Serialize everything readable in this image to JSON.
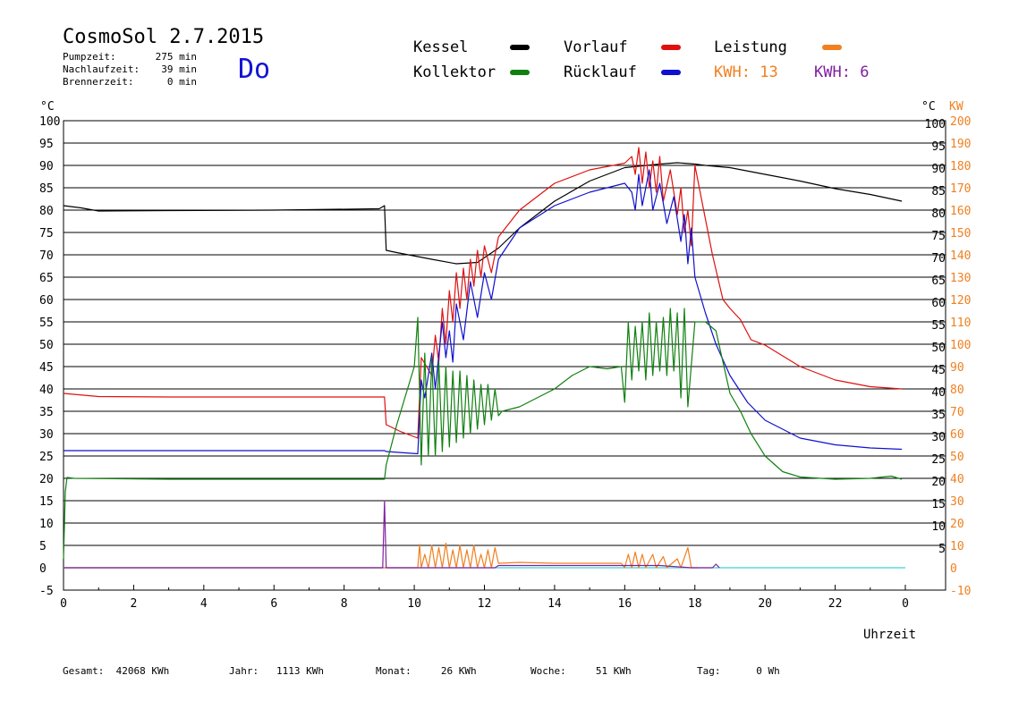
{
  "header": {
    "title": "CosmoSol 2.7.2015",
    "day": "Do",
    "stats": [
      {
        "label": "Pumpzeit:",
        "value": "275 min"
      },
      {
        "label": "Nachlaufzeit:",
        "value": "39 min"
      },
      {
        "label": "Brennerzeit:",
        "value": "0 min"
      }
    ]
  },
  "legend": {
    "kessel": {
      "label": "Kessel",
      "color": "#000000"
    },
    "vorlauf": {
      "label": "Vorlauf",
      "color": "#e01010"
    },
    "leistung": {
      "label": "Leistung",
      "color": "#f08020"
    },
    "kollektor": {
      "label": "Kollektor",
      "color": "#108010"
    },
    "ruecklauf": {
      "label": "Rücklauf",
      "color": "#1010d0"
    },
    "kwh1": {
      "label": "KWH:",
      "value": "13",
      "color": "#f08020"
    },
    "kwh2": {
      "label": "KWH:",
      "value": "6",
      "color": "#8020a0"
    }
  },
  "axis_units": {
    "left": "°C",
    "right_temp": "°C",
    "right_power": "KW",
    "x": "Uhrzeit"
  },
  "footer": [
    {
      "label": "Gesamt:",
      "value": "42068 KWh"
    },
    {
      "label": "Jahr:",
      "value": "1113 KWh"
    },
    {
      "label": "Monat:",
      "value": "26 KWh"
    },
    {
      "label": "Woche:",
      "value": "51 KWh"
    },
    {
      "label": "Tag:",
      "value": "0 Wh"
    }
  ],
  "chart_data": {
    "type": "line",
    "xlabel": "Uhrzeit",
    "ylabel": "°C",
    "y2label": "KW",
    "xlim": [
      0,
      24.5
    ],
    "ylim": [
      -5,
      100
    ],
    "y2lim": [
      -10,
      200
    ],
    "x_ticks": [
      "0",
      "2",
      "4",
      "6",
      "8",
      "10",
      "12",
      "14",
      "16",
      "18",
      "20",
      "22",
      "0"
    ],
    "y_ticks_left": [
      "100",
      "95",
      "90",
      "85",
      "80",
      "75",
      "70",
      "65",
      "60",
      "55",
      "50",
      "45",
      "40",
      "35",
      "30",
      "25",
      "20",
      "15",
      "10",
      "5",
      "0",
      "-5"
    ],
    "y_ticks_right_temp": [
      "100",
      "95",
      "90",
      "85",
      "80",
      "75",
      "70",
      "65",
      "60",
      "55",
      "50",
      "45",
      "40",
      "35",
      "30",
      "25",
      "20",
      "15",
      "10",
      "5"
    ],
    "y_ticks_right_power": [
      "200",
      "190",
      "180",
      "170",
      "160",
      "150",
      "140",
      "130",
      "120",
      "110",
      "100",
      "90",
      "80",
      "70",
      "60",
      "50",
      "40",
      "30",
      "20",
      "10",
      "0",
      "-10"
    ],
    "grid": true,
    "colors": {
      "kessel": "#000000",
      "vorlauf": "#e01010",
      "ruecklauf": "#1010d0",
      "kollektor": "#108010",
      "leistung": "#f08020",
      "kwh2": "#8020a0",
      "baseline": "#40d0d0"
    },
    "series": [
      {
        "name": "Kessel",
        "key": "kessel",
        "points": [
          [
            0,
            81
          ],
          [
            0.5,
            80.5
          ],
          [
            1,
            79.8
          ],
          [
            3,
            79.9
          ],
          [
            6,
            80
          ],
          [
            9.0,
            80.3
          ],
          [
            9.15,
            81
          ],
          [
            9.2,
            71
          ],
          [
            9.5,
            70.5
          ],
          [
            10.5,
            69
          ],
          [
            11.2,
            68
          ],
          [
            11.8,
            68.3
          ],
          [
            12.4,
            71.5
          ],
          [
            13,
            76
          ],
          [
            14,
            82
          ],
          [
            15,
            86.5
          ],
          [
            16,
            89.5
          ],
          [
            17,
            90.3
          ],
          [
            17.5,
            90.6
          ],
          [
            18,
            90.3
          ],
          [
            18.3,
            90
          ],
          [
            19,
            89.5
          ],
          [
            20,
            88
          ],
          [
            21,
            86.5
          ],
          [
            22,
            84.8
          ],
          [
            23,
            83.5
          ],
          [
            23.9,
            82
          ]
        ]
      },
      {
        "name": "Vorlauf",
        "key": "vorlauf",
        "points": [
          [
            0,
            39
          ],
          [
            1,
            38.3
          ],
          [
            3,
            38.2
          ],
          [
            6,
            38.2
          ],
          [
            9.15,
            38.2
          ],
          [
            9.2,
            32
          ],
          [
            9.6,
            30.5
          ],
          [
            10.1,
            29
          ],
          [
            10.2,
            47
          ],
          [
            10.5,
            43
          ],
          [
            10.6,
            52
          ],
          [
            10.7,
            46
          ],
          [
            10.8,
            58
          ],
          [
            10.9,
            50
          ],
          [
            11,
            62
          ],
          [
            11.1,
            55
          ],
          [
            11.2,
            66
          ],
          [
            11.3,
            58
          ],
          [
            11.4,
            67
          ],
          [
            11.5,
            60
          ],
          [
            11.6,
            69
          ],
          [
            11.7,
            63
          ],
          [
            11.8,
            71
          ],
          [
            11.9,
            65
          ],
          [
            12,
            72
          ],
          [
            12.2,
            66
          ],
          [
            12.4,
            74
          ],
          [
            13,
            80
          ],
          [
            14,
            86
          ],
          [
            15,
            89
          ],
          [
            16,
            90.5
          ],
          [
            16.2,
            92
          ],
          [
            16.3,
            88
          ],
          [
            16.4,
            94
          ],
          [
            16.5,
            86
          ],
          [
            16.6,
            93
          ],
          [
            16.7,
            85
          ],
          [
            16.8,
            91
          ],
          [
            16.9,
            84
          ],
          [
            17,
            92
          ],
          [
            17.1,
            82
          ],
          [
            17.3,
            89
          ],
          [
            17.5,
            79
          ],
          [
            17.6,
            85
          ],
          [
            17.7,
            75
          ],
          [
            17.8,
            80
          ],
          [
            17.9,
            72
          ],
          [
            18,
            90
          ],
          [
            18.2,
            82
          ],
          [
            18.5,
            70
          ],
          [
            18.8,
            60
          ],
          [
            19,
            58
          ],
          [
            19.3,
            55.5
          ],
          [
            19.6,
            51
          ],
          [
            20,
            49.8
          ],
          [
            21,
            45
          ],
          [
            22,
            42
          ],
          [
            23,
            40.5
          ],
          [
            23.9,
            40
          ]
        ]
      },
      {
        "name": "Rücklauf",
        "key": "ruecklauf",
        "points": [
          [
            0,
            26.2
          ],
          [
            3,
            26.2
          ],
          [
            6,
            26.2
          ],
          [
            9.15,
            26.2
          ],
          [
            9.2,
            26
          ],
          [
            10.1,
            25.5
          ],
          [
            10.2,
            42
          ],
          [
            10.3,
            38
          ],
          [
            10.5,
            48
          ],
          [
            10.6,
            40
          ],
          [
            10.8,
            55
          ],
          [
            10.9,
            47
          ],
          [
            11,
            53
          ],
          [
            11.1,
            46
          ],
          [
            11.2,
            59
          ],
          [
            11.4,
            51
          ],
          [
            11.6,
            64
          ],
          [
            11.8,
            56
          ],
          [
            12,
            66
          ],
          [
            12.2,
            60
          ],
          [
            12.4,
            69
          ],
          [
            13,
            76
          ],
          [
            14,
            81
          ],
          [
            14.5,
            82.5
          ],
          [
            15,
            84
          ],
          [
            16,
            86
          ],
          [
            16.2,
            84
          ],
          [
            16.3,
            80
          ],
          [
            16.4,
            88
          ],
          [
            16.5,
            81
          ],
          [
            16.7,
            89
          ],
          [
            16.8,
            80
          ],
          [
            17,
            86
          ],
          [
            17.2,
            77
          ],
          [
            17.4,
            83
          ],
          [
            17.6,
            73
          ],
          [
            17.7,
            79
          ],
          [
            17.8,
            68
          ],
          [
            17.9,
            76
          ],
          [
            18,
            65
          ],
          [
            18.3,
            57
          ],
          [
            18.6,
            50
          ],
          [
            19,
            43
          ],
          [
            19.5,
            37
          ],
          [
            20,
            33
          ],
          [
            21,
            29
          ],
          [
            22,
            27.5
          ],
          [
            23,
            26.8
          ],
          [
            23.9,
            26.5
          ]
        ]
      },
      {
        "name": "Kollektor",
        "key": "kollektor",
        "points": [
          [
            0,
            2
          ],
          [
            0.05,
            17
          ],
          [
            0.1,
            20.2
          ],
          [
            0.3,
            20
          ],
          [
            3,
            19.8
          ],
          [
            6,
            19.8
          ],
          [
            9.15,
            19.8
          ],
          [
            9.2,
            23
          ],
          [
            9.5,
            32
          ],
          [
            10,
            45
          ],
          [
            10.1,
            56
          ],
          [
            10.2,
            23
          ],
          [
            10.3,
            48
          ],
          [
            10.4,
            25
          ],
          [
            10.5,
            47
          ],
          [
            10.6,
            25
          ],
          [
            10.7,
            46
          ],
          [
            10.8,
            26
          ],
          [
            10.9,
            45
          ],
          [
            11,
            27
          ],
          [
            11.1,
            44
          ],
          [
            11.2,
            28
          ],
          [
            11.3,
            44
          ],
          [
            11.4,
            29
          ],
          [
            11.5,
            43
          ],
          [
            11.6,
            30
          ],
          [
            11.7,
            42
          ],
          [
            11.8,
            31
          ],
          [
            11.9,
            41
          ],
          [
            12,
            32
          ],
          [
            12.1,
            41
          ],
          [
            12.2,
            33
          ],
          [
            12.3,
            40
          ],
          [
            12.4,
            34
          ],
          [
            12.5,
            35
          ],
          [
            13,
            36
          ],
          [
            13.5,
            38
          ],
          [
            14,
            40
          ],
          [
            14.5,
            43
          ],
          [
            15,
            45
          ],
          [
            15.5,
            44.5
          ],
          [
            15.9,
            45
          ],
          [
            16,
            37
          ],
          [
            16.1,
            55
          ],
          [
            16.2,
            42
          ],
          [
            16.3,
            54
          ],
          [
            16.4,
            44
          ],
          [
            16.5,
            55
          ],
          [
            16.6,
            42
          ],
          [
            16.7,
            57
          ],
          [
            16.8,
            43
          ],
          [
            16.9,
            55
          ],
          [
            17,
            44
          ],
          [
            17.1,
            56
          ],
          [
            17.2,
            43
          ],
          [
            17.3,
            58
          ],
          [
            17.4,
            44
          ],
          [
            17.5,
            57
          ],
          [
            17.6,
            38
          ],
          [
            17.7,
            58
          ],
          [
            17.8,
            36
          ],
          [
            18,
            55
          ],
          [
            18.3,
            55
          ],
          [
            18.6,
            53
          ],
          [
            19,
            39
          ],
          [
            19.3,
            35
          ],
          [
            19.6,
            30
          ],
          [
            20,
            25
          ],
          [
            20.5,
            21.5
          ],
          [
            21,
            20.3
          ],
          [
            22,
            19.8
          ],
          [
            23,
            20
          ],
          [
            23.6,
            20.5
          ],
          [
            23.9,
            19.8
          ]
        ]
      },
      {
        "name": "Leistung",
        "key": "leistung",
        "points": [
          [
            0,
            0
          ],
          [
            10,
            0
          ],
          [
            10.1,
            0
          ],
          [
            10.15,
            5.2
          ],
          [
            10.2,
            0
          ],
          [
            10.3,
            3
          ],
          [
            10.4,
            0
          ],
          [
            10.5,
            5
          ],
          [
            10.6,
            0
          ],
          [
            10.7,
            4.5
          ],
          [
            10.8,
            0
          ],
          [
            10.9,
            5.5
          ],
          [
            11,
            0
          ],
          [
            11.1,
            4
          ],
          [
            11.2,
            0
          ],
          [
            11.3,
            5
          ],
          [
            11.4,
            0
          ],
          [
            11.5,
            4
          ],
          [
            11.6,
            0
          ],
          [
            11.7,
            5
          ],
          [
            11.8,
            0
          ],
          [
            11.9,
            3
          ],
          [
            12,
            0
          ],
          [
            12.1,
            4
          ],
          [
            12.2,
            0
          ],
          [
            12.3,
            4.5
          ],
          [
            12.4,
            1
          ],
          [
            13,
            1.2
          ],
          [
            14,
            1
          ],
          [
            15,
            1
          ],
          [
            15.9,
            1
          ],
          [
            16,
            0
          ],
          [
            16.1,
            3
          ],
          [
            16.2,
            0
          ],
          [
            16.3,
            3.5
          ],
          [
            16.4,
            0
          ],
          [
            16.5,
            3
          ],
          [
            16.6,
            0
          ],
          [
            16.8,
            3
          ],
          [
            16.9,
            0
          ],
          [
            17.1,
            2.5
          ],
          [
            17.2,
            0
          ],
          [
            17.5,
            2
          ],
          [
            17.6,
            0
          ],
          [
            17.8,
            4.5
          ],
          [
            17.9,
            0
          ],
          [
            18.1,
            0
          ]
        ]
      },
      {
        "name": "Leistung (2)",
        "key": "kwh2",
        "points": [
          [
            0,
            0
          ],
          [
            9.1,
            0
          ],
          [
            9.15,
            15
          ],
          [
            9.2,
            0
          ],
          [
            12.3,
            0
          ],
          [
            12.4,
            0.5
          ],
          [
            13,
            0.5
          ],
          [
            14,
            0.5
          ],
          [
            15,
            0.5
          ],
          [
            16,
            0.5
          ],
          [
            17,
            0.5
          ],
          [
            17.9,
            0
          ],
          [
            18.5,
            0
          ],
          [
            18.6,
            0.8
          ],
          [
            18.7,
            0
          ]
        ]
      }
    ]
  }
}
